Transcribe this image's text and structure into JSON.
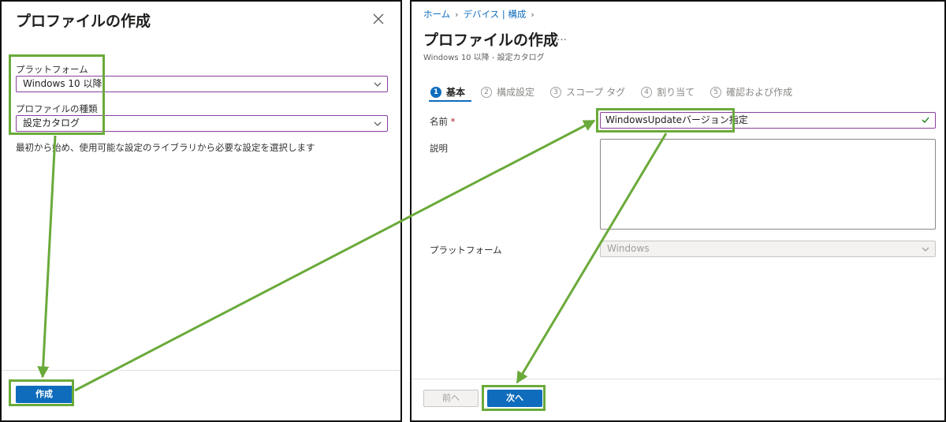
{
  "left_panel": {
    "title": "プロファイルの作成",
    "platform_label": "プラットフォーム",
    "platform_value": "Windows 10 以降",
    "profile_type_label": "プロファイルの種類",
    "profile_type_value": "設定カタログ",
    "description": "最初から始め、使用可能な設定のライブラリから必要な設定を選択します",
    "create_button": "作成",
    "close_icon": "close-icon"
  },
  "right_panel": {
    "breadcrumb": [
      "ホーム",
      "デバイス | 構成"
    ],
    "title": "プロファイルの作成",
    "more": "…",
    "subtitle": "Windows 10 以降 - 設定カタログ",
    "steps": [
      {
        "num": "1",
        "label": "基本",
        "active": true
      },
      {
        "num": "2",
        "label": "構成設定",
        "active": false
      },
      {
        "num": "3",
        "label": "スコープ タグ",
        "active": false
      },
      {
        "num": "4",
        "label": "割り当て",
        "active": false
      },
      {
        "num": "5",
        "label": "確認および作成",
        "active": false
      }
    ],
    "name_label": "名前",
    "required_mark": "*",
    "name_value": "WindowsUpdateバージョン指定",
    "description_label": "説明",
    "platform_label": "プラットフォーム",
    "platform_value": "Windows",
    "prev_button": "前へ",
    "next_button": "次へ"
  },
  "colors": {
    "accent": "#0f6cbd",
    "highlight": "#6aaa3a",
    "input_border": "#8a3f9e",
    "check": "#107c10"
  }
}
